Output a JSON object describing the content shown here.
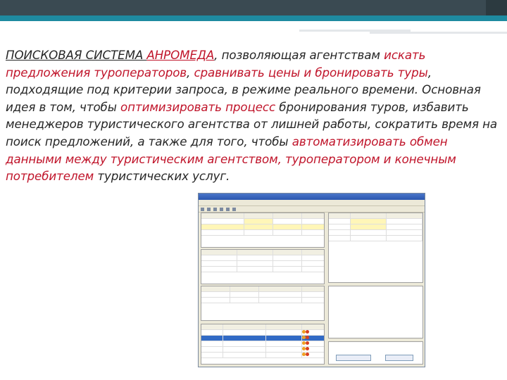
{
  "slide": {
    "colors": {
      "topbar": "#3a4a52",
      "stripe": "#1e8aa0",
      "highlight": "#c0142a",
      "body_text": "#262626"
    },
    "text": {
      "p1_a": "ПОИСКОВАЯ СИСТЕМА ",
      "p1_hl1": "АНРОМЕДА",
      "p1_b": ", позволяющая агентствам ",
      "p1_hl2": "искать предложения туроператоров",
      "p1_c": ", ",
      "p1_hl3": "сравнивать цены и бронировать туры",
      "p1_d": ", подходящие под критерии запроса, в режиме реального времени. Основная идея в том, чтобы ",
      "p1_hl4": "оптимизировать процесс",
      "p1_e": " бронирования туров, избавить менеджеров туристического агентства от лишней работы, сократить время на поиск предложений, а также для того, чтобы ",
      "p1_hl5": "автоматизировать обмен данными между туристическим агентством, туроператором и конечным потребителем",
      "p1_f": " туристических услуг."
    }
  },
  "screenshot": {
    "icon": "application-screenshot"
  }
}
